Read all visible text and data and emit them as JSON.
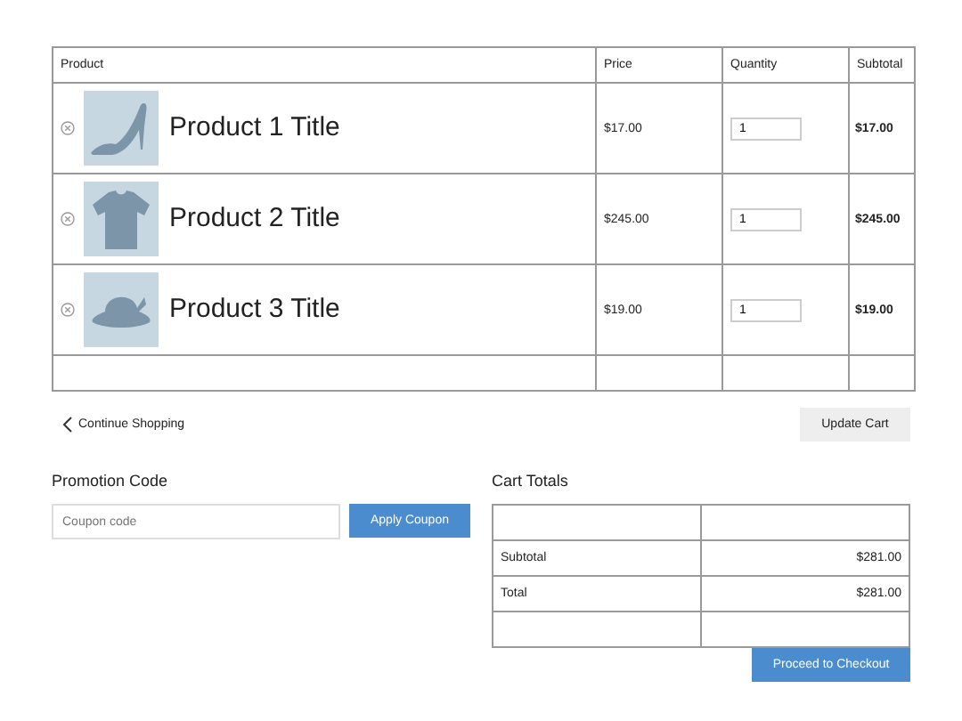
{
  "cart_table": {
    "columns": [
      "Product",
      "Price",
      "Quantity",
      "Subtotal"
    ],
    "rows": [
      {
        "title": "Product 1 Title",
        "price": "$17.00",
        "quantity": "1",
        "subtotal": "$17.00"
      },
      {
        "title": "Product 2 Title",
        "price": "$245.00",
        "quantity": "1",
        "subtotal": "$245.00"
      },
      {
        "title": "Product 3 Title",
        "price": "$19.00",
        "quantity": "1",
        "subtotal": "$19.00"
      }
    ]
  },
  "continue_link": "Continue Shopping",
  "update_button": "Update Cart",
  "promotion": {
    "heading": "Promotion Code",
    "placeholder": "Coupon code",
    "button": "Apply Coupon"
  },
  "totals": {
    "heading": "Cart Totals",
    "rows": [
      {
        "label": "Subtotal",
        "value": "$281.00"
      },
      {
        "label": "Total",
        "value": "$281.00"
      }
    ],
    "button": "Proceed to Checkout"
  }
}
